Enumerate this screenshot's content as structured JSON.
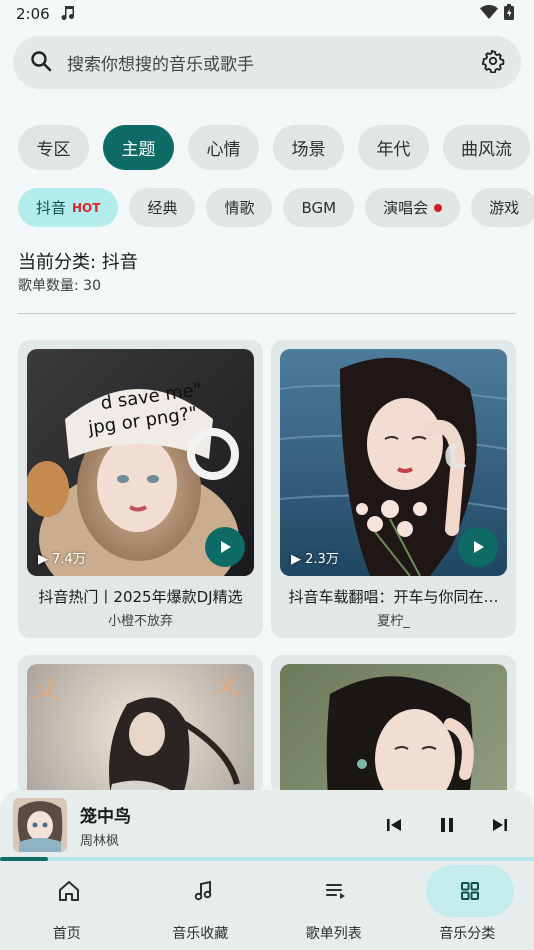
{
  "status": {
    "time": "2:06"
  },
  "search": {
    "placeholder": "搜索你想搜的音乐或歌手"
  },
  "primary_tabs": [
    "专区",
    "主题",
    "心情",
    "场景",
    "年代",
    "曲风流"
  ],
  "primary_active": "主题",
  "secondary_tabs": [
    {
      "label": "抖音",
      "badge": "HOT"
    },
    {
      "label": "经典"
    },
    {
      "label": "情歌"
    },
    {
      "label": "BGM"
    },
    {
      "label": "演唱会",
      "dot": true
    },
    {
      "label": "游戏"
    }
  ],
  "secondary_active": "抖音",
  "info": {
    "category": "当前分类: 抖音",
    "count": "歌单数量: 30"
  },
  "playlists": [
    {
      "title": "抖音热门丨2025年爆款DJ精选",
      "author": "小橙不放弃",
      "plays": "7.4万"
    },
    {
      "title": "抖音车载翻唱：开车与你同在…",
      "author": "夏柠_",
      "plays": "2.3万"
    },
    {
      "title": "",
      "author": "",
      "plays": ""
    },
    {
      "title": "",
      "author": "",
      "plays": ""
    }
  ],
  "now_playing": {
    "song": "笼中鸟",
    "artist": "周林枫",
    "progress": 0.09
  },
  "nav": [
    {
      "label": "首页",
      "icon": "home-icon"
    },
    {
      "label": "音乐收藏",
      "icon": "music-note-icon"
    },
    {
      "label": "歌单列表",
      "icon": "playlist-icon"
    },
    {
      "label": "音乐分类",
      "icon": "grid-icon",
      "active": true
    }
  ],
  "colors": {
    "accent": "#0f6b66",
    "chip_active_light": "#b3ecec",
    "hot": "#d9272e"
  }
}
